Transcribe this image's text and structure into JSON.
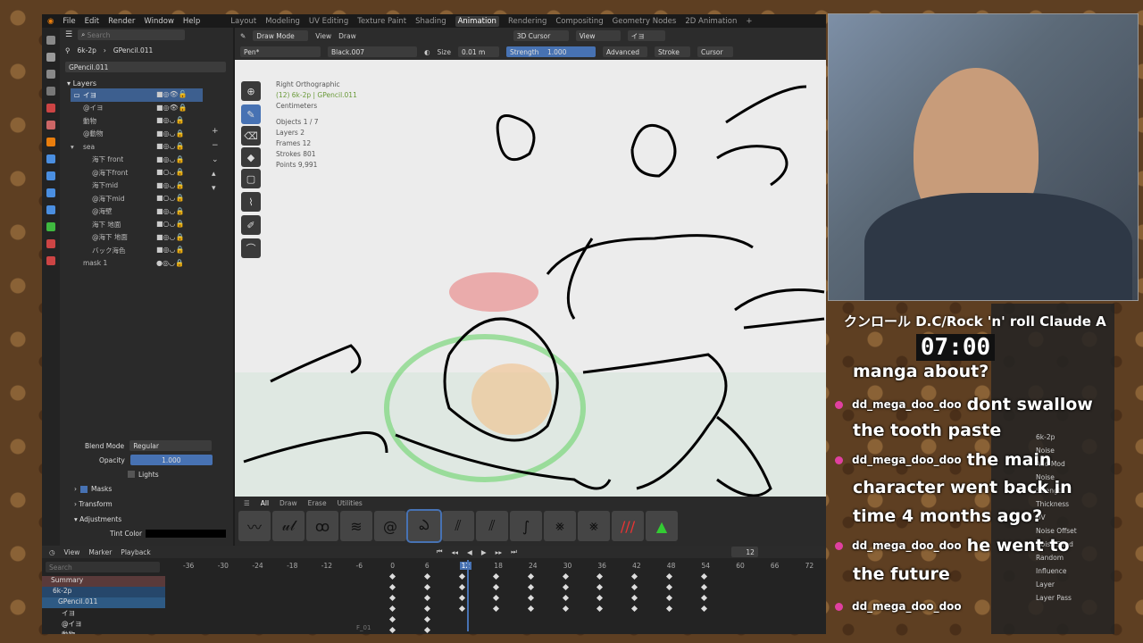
{
  "menubar": {
    "items": [
      "File",
      "Edit",
      "Render",
      "Window",
      "Help"
    ],
    "workspaces": [
      "Layout",
      "Modeling",
      "UV Editing",
      "Texture Paint",
      "Shading",
      "Animation",
      "Rendering",
      "Compositing",
      "Geometry Nodes",
      "2D Animation",
      "+"
    ],
    "active": "Animation"
  },
  "outliner": {
    "search_placeholder": "Search",
    "object": "6k-2p",
    "gpencil": "GPencil.011",
    "data_name": "GPencil.011",
    "layers_title": "Layers",
    "layers": [
      "イヨ",
      "@イヨ",
      "動物",
      "@動物",
      "sea",
      "海下 front",
      "@海下front",
      "海下mid",
      "@海下mid",
      "@海壁",
      "海下 地面",
      "@海下 地面",
      "バック海色",
      "mask 1"
    ],
    "blend_mode_label": "Blend Mode",
    "blend_mode": "Regular",
    "opacity_label": "Opacity",
    "opacity": "1.000",
    "lights": "Lights",
    "masks": "Masks",
    "transform": "Transform",
    "adjustments": "Adjustments",
    "tint_color": "Tint Color"
  },
  "viewport": {
    "mode": "Draw Mode",
    "view": "View",
    "draw": "Draw",
    "cursor": "3D Cursor",
    "view2": "View",
    "layer": "イヨ",
    "tool": "Pen*",
    "material": "Black.007",
    "size_label": "Size",
    "size": "0.01 m",
    "strength_label": "Strength",
    "strength": "1.000",
    "advanced": "Advanced",
    "stroke": "Stroke",
    "cursor2": "Cursor",
    "info": {
      "view_name": "Right Orthographic",
      "context": "(12) 6k-2p | GPencil.011",
      "units": "Centimeters",
      "objects": "Objects    1 / 7",
      "layers": "Layers     2",
      "frames": "Frames    12",
      "strokes": "Strokes   801",
      "points": "Points     9,991"
    }
  },
  "brushbar": {
    "tabs": [
      "All",
      "Draw",
      "Erase",
      "Utilities"
    ]
  },
  "timeline": {
    "view": "View",
    "marker": "Marker",
    "playback": "Playback",
    "frame": "12",
    "search": "Search",
    "summary": "Summary",
    "obj": "6k-2p",
    "gp": "GPencil.011",
    "l1": "イヨ",
    "l2": "@イヨ",
    "l3": "動物",
    "ticks": [
      "-36",
      "-30",
      "-24",
      "-18",
      "-12",
      "-6",
      "0",
      "6",
      "12",
      "18",
      "24",
      "30",
      "36",
      "42",
      "48",
      "54",
      "60",
      "66",
      "72"
    ],
    "frame_marker": "F_01"
  },
  "stream": {
    "song": "クンロール D.C/Rock 'n' roll Claude A",
    "timer": "07:00",
    "chat": [
      "manga about?",
      "dd_mega_doo_doo",
      "dont swallow",
      "the tooth paste",
      "dd_mega_doo_doo",
      "the main",
      "character went back in",
      "time 4 months ago?",
      "dd_mega_doo_doo",
      "he went to",
      "the future",
      "dd_mega_doo_doo"
    ]
  },
  "rightpanel": {
    "items": [
      "6k-2p",
      "Noise",
      "Add Mod",
      "Noise",
      "Strength",
      "Thickness",
      "UV",
      "Noise Offset",
      "Noise Seed",
      "Random",
      "Influence",
      "Layer",
      "Layer Pass"
    ]
  },
  "colors": {
    "accent": "#4772b3",
    "pink": "#e040a0",
    "sketch_green": "#3fb83f"
  }
}
